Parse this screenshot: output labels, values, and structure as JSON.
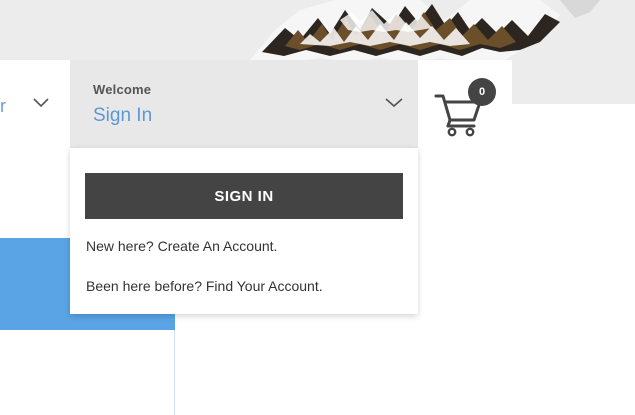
{
  "account": {
    "greeting": "Welcome",
    "sign_in_link": "Sign In"
  },
  "nav": {
    "partial_label": "r"
  },
  "cart": {
    "count": "0"
  },
  "dropdown": {
    "sign_in_button": "SIGN IN",
    "new_here_prefix": "New here? ",
    "create_account_link": "Create An Account.",
    "been_here_prefix": "Been here before? ",
    "find_account_link": "Find Your Account."
  },
  "colors": {
    "link_blue": "#5c98d8",
    "button_dark": "#444444",
    "panel_blue": "#5aa4e6",
    "header_gray": "#e8e8e8"
  },
  "icons": {
    "cart": "cart-icon",
    "chevron": "chevron-down-icon"
  }
}
